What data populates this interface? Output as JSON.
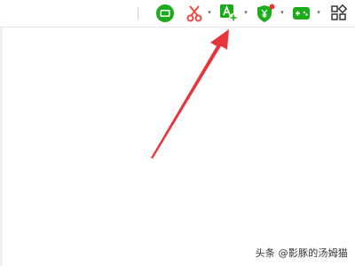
{
  "toolbar": {
    "tools": [
      {
        "name": "screen-recorder-icon",
        "color": "#1aad19"
      },
      {
        "name": "scissors-icon",
        "color": "#e54d42"
      },
      {
        "name": "translate-icon",
        "color": "#1aad19"
      },
      {
        "name": "security-shield-icon",
        "color": "#1aad19"
      },
      {
        "name": "gamepad-icon",
        "color": "#1aad19"
      },
      {
        "name": "apps-grid-icon",
        "color": "#333333"
      }
    ],
    "caret_glyph": "▾"
  },
  "annotation": {
    "color": "#e8343b"
  },
  "watermark": {
    "text": "头条 @影豚的汤姆猫"
  }
}
